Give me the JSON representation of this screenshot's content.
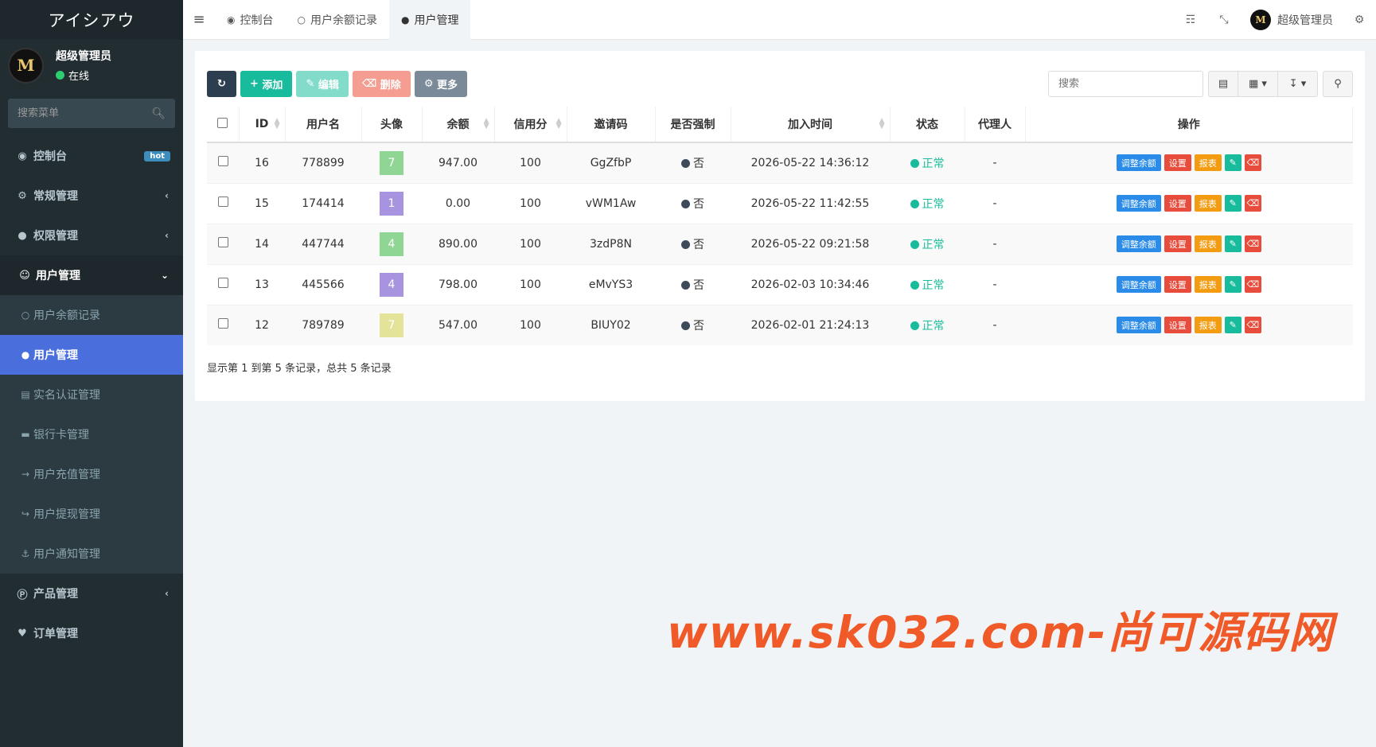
{
  "brand": "アイシアウ",
  "user": {
    "name": "超级管理员",
    "status": "在线",
    "avatar_letter": "M"
  },
  "sidebar": {
    "search_placeholder": "搜索菜单",
    "items": [
      {
        "label": "控制台",
        "icon": "dashboard-icon",
        "badge": "hot"
      },
      {
        "label": "常规管理",
        "icon": "cogs-icon"
      },
      {
        "label": "权限管理",
        "icon": "group-icon"
      },
      {
        "label": "用户管理",
        "icon": "user-circle-icon"
      }
    ],
    "sub_items": [
      {
        "label": "用户余额记录",
        "icon": "circle-outline-icon"
      },
      {
        "label": "用户管理",
        "icon": "user-icon"
      },
      {
        "label": "实名认证管理",
        "icon": "id-card-icon"
      },
      {
        "label": "银行卡管理",
        "icon": "credit-card-icon"
      },
      {
        "label": "用户充值管理",
        "icon": "sign-in-icon"
      },
      {
        "label": "用户提现管理",
        "icon": "sign-out-icon"
      },
      {
        "label": "用户通知管理",
        "icon": "anchor-icon"
      }
    ],
    "items_after": [
      {
        "label": "产品管理",
        "icon": "product-icon"
      },
      {
        "label": "订单管理",
        "icon": "heartbeat-icon"
      }
    ]
  },
  "header": {
    "tabs": [
      {
        "label": "控制台",
        "icon": "dashboard-icon"
      },
      {
        "label": "用户余额记录",
        "icon": "circle-outline-icon"
      },
      {
        "label": "用户管理",
        "icon": "user-icon"
      }
    ],
    "user_name": "超级管理员"
  },
  "toolbar": {
    "add": "添加",
    "edit": "编辑",
    "delete": "删除",
    "more": "更多"
  },
  "search_placeholder": "搜索",
  "table": {
    "columns": [
      "ID",
      "用户名",
      "头像",
      "余额",
      "信用分",
      "邀请码",
      "是否强制",
      "加入时间",
      "状态",
      "代理人",
      "操作"
    ],
    "rows": [
      {
        "id": "16",
        "username": "778899",
        "avatar": "7",
        "avatar_color": "#8fd694",
        "balance": "947.00",
        "credit": "100",
        "code": "GgZfbP",
        "forced": "否",
        "joined": "2026-05-22 14:36:12",
        "status": "正常",
        "agent": "-"
      },
      {
        "id": "15",
        "username": "174414",
        "avatar": "1",
        "avatar_color": "#a793e0",
        "balance": "0.00",
        "credit": "100",
        "code": "vWM1Aw",
        "forced": "否",
        "joined": "2026-05-22 11:42:55",
        "status": "正常",
        "agent": "-"
      },
      {
        "id": "14",
        "username": "447744",
        "avatar": "4",
        "avatar_color": "#8fd694",
        "balance": "890.00",
        "credit": "100",
        "code": "3zdP8N",
        "forced": "否",
        "joined": "2026-05-22 09:21:58",
        "status": "正常",
        "agent": "-"
      },
      {
        "id": "13",
        "username": "445566",
        "avatar": "4",
        "avatar_color": "#a793e0",
        "balance": "798.00",
        "credit": "100",
        "code": "eMvYS3",
        "forced": "否",
        "joined": "2026-02-03 10:34:46",
        "status": "正常",
        "agent": "-"
      },
      {
        "id": "12",
        "username": "789789",
        "avatar": "7",
        "avatar_color": "#e3e39a",
        "balance": "547.00",
        "credit": "100",
        "code": "BIUY02",
        "forced": "否",
        "joined": "2026-02-01 21:24:13",
        "status": "正常",
        "agent": "-"
      }
    ],
    "actions": {
      "adjust": "调整余额",
      "settings": "设置",
      "report": "报表"
    }
  },
  "footer": "显示第 1 到第 5 条记录，总共 5 条记录",
  "watermark": "www.sk032.com-尚可源码网"
}
